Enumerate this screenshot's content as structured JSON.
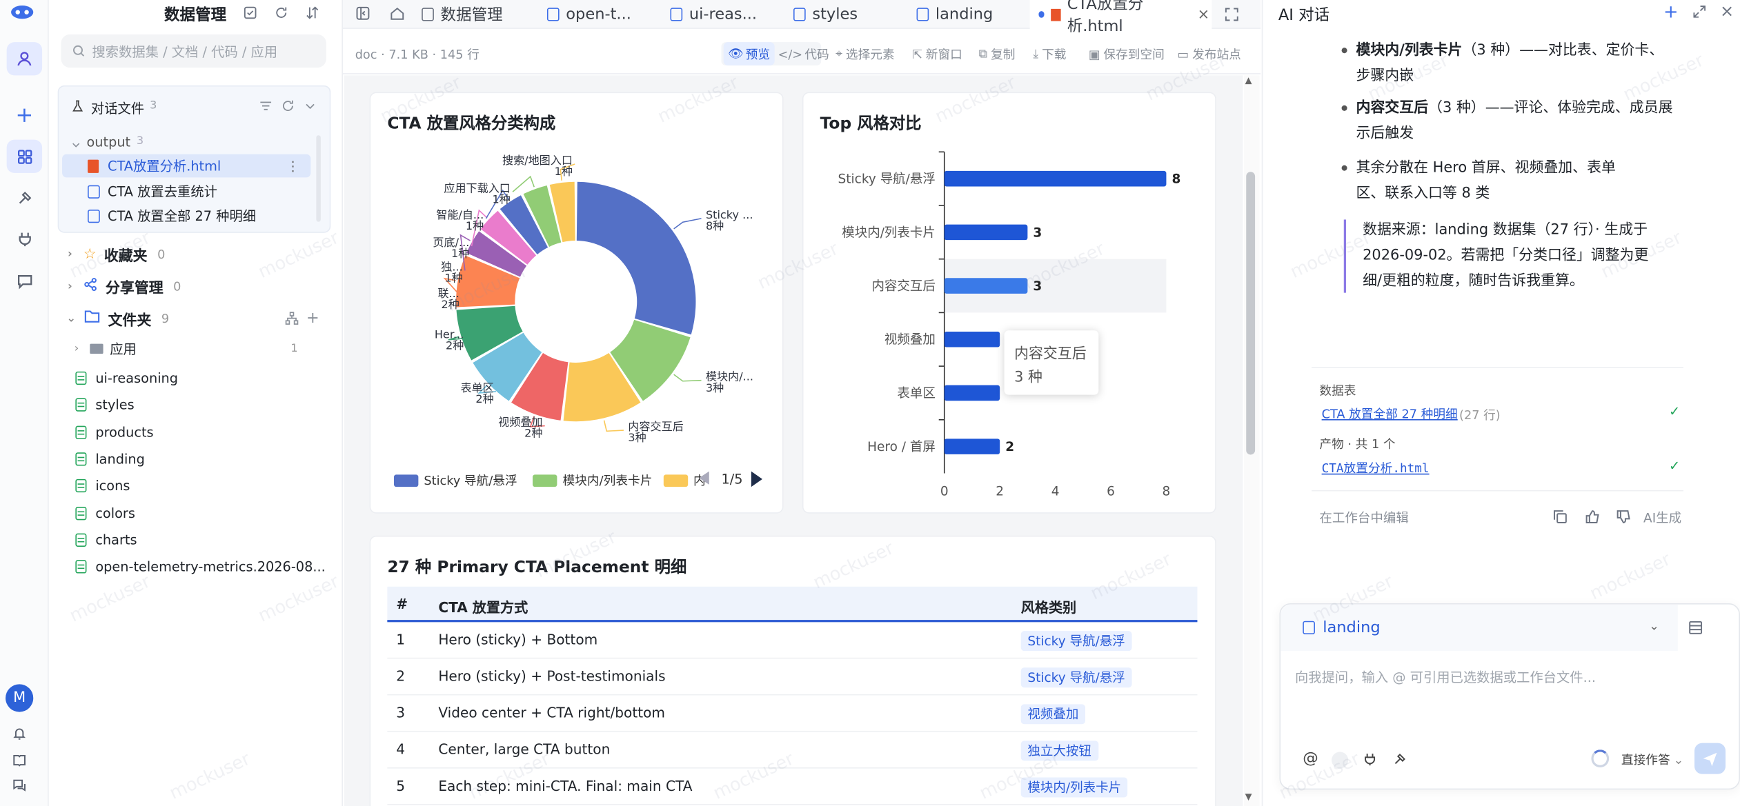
{
  "sidebar": {
    "title": "数据管理",
    "search_placeholder": "搜索数据集 / 文档 / 代码 / 应用",
    "conversation": {
      "label": "对话文件",
      "count": "3"
    },
    "output": {
      "label": "output",
      "count": "3"
    },
    "output_files": [
      "CTA放置分析.html",
      "CTA 放置去重统计",
      "CTA 放置全部 27 种明细"
    ],
    "favorites": {
      "label": "收藏夹",
      "count": "0"
    },
    "shares": {
      "label": "分享管理",
      "count": "0"
    },
    "folders": {
      "label": "文件夹",
      "count": "9"
    },
    "apps": {
      "label": "应用",
      "count": "1"
    },
    "files": [
      "ui-reasoning",
      "styles",
      "products",
      "landing",
      "icons",
      "colors",
      "charts",
      "open-telemetry-metrics.2026-08..."
    ],
    "avatar_letter": "M"
  },
  "tabs": [
    {
      "label": "数据管理"
    },
    {
      "label": "open-t..."
    },
    {
      "label": "ui-reas..."
    },
    {
      "label": "styles"
    },
    {
      "label": "landing"
    },
    {
      "label": "CTA放置分析.html"
    }
  ],
  "toolbar": {
    "meta": "doc · 7.1 KB · 145 行",
    "preview": "预览",
    "code": "代码",
    "select": "选择元素",
    "new_window": "新窗口",
    "copy": "复制",
    "download": "下载",
    "save": "保存到空间",
    "publish": "发布站点"
  },
  "pie_card": {
    "title": "CTA 放置风格分类构成",
    "legend_page": "1/5",
    "legend": [
      {
        "label": "Sticky 导航/悬浮",
        "color": "#5470c6"
      },
      {
        "label": "模块内/列表卡片",
        "color": "#91cc75"
      },
      {
        "label": "内",
        "color": "#fac858"
      }
    ]
  },
  "chart_data": [
    {
      "type": "pie",
      "title": "CTA 放置风格分类构成",
      "slices": [
        {
          "label": "Sticky ...",
          "value": 8,
          "value_label": "8种",
          "color": "#5470c6"
        },
        {
          "label": "模块内/...",
          "value": 3,
          "value_label": "3种",
          "color": "#91cc75"
        },
        {
          "label": "内容交互后",
          "value": 3,
          "value_label": "3种",
          "color": "#fac858"
        },
        {
          "label": "视频叠加",
          "value": 2,
          "value_label": "2种",
          "color": "#ee6666"
        },
        {
          "label": "表单区",
          "value": 2,
          "value_label": "2种",
          "color": "#73c0de"
        },
        {
          "label": "Her...",
          "value": 2,
          "value_label": "2种",
          "color": "#3ba272"
        },
        {
          "label": "联...",
          "value": 2,
          "value_label": "2种",
          "color": "#fc8452"
        },
        {
          "label": "独...",
          "value": 1,
          "value_label": "1种",
          "color": "#9a60b4"
        },
        {
          "label": "页底/...",
          "value": 1,
          "value_label": "1种",
          "color": "#ea7ccc"
        },
        {
          "label": "智能/自...",
          "value": 1,
          "value_label": "1种",
          "color": "#5470c6"
        },
        {
          "label": "应用下载入口",
          "value": 1,
          "value_label": "1种",
          "color": "#91cc75"
        },
        {
          "label": "搜索/地图入口",
          "value": 1,
          "value_label": "1种",
          "color": "#fac858"
        }
      ]
    },
    {
      "type": "bar",
      "orientation": "horizontal",
      "title": "Top 风格对比",
      "categories": [
        "Sticky 导航/悬浮",
        "模块内/列表卡片",
        "内容交互后",
        "视频叠加",
        "表单区",
        "Hero / 首屏"
      ],
      "values": [
        8,
        3,
        3,
        2,
        2,
        2
      ],
      "value_labels": [
        "8",
        "3",
        "3",
        "",
        "",
        "2"
      ],
      "xlim": [
        0,
        8
      ],
      "xticks": [
        "0",
        "2",
        "4",
        "6",
        "8"
      ],
      "bar_color": "#1e56d6",
      "highlight_color": "#3a7ae8",
      "highlight_index": 2,
      "tooltip": {
        "title": "内容交互后",
        "value": "3 种"
      }
    }
  ],
  "table": {
    "title": "27 种 Primary CTA Placement 明细",
    "headers": [
      "#",
      "CTA 放置方式",
      "风格类别"
    ],
    "rows": [
      [
        "1",
        "Hero (sticky) + Bottom",
        "Sticky 导航/悬浮"
      ],
      [
        "2",
        "Hero (sticky) + Post-testimonials",
        "Sticky 导航/悬浮"
      ],
      [
        "3",
        "Video center + CTA right/bottom",
        "视频叠加"
      ],
      [
        "4",
        "Center, large CTA button",
        "独立大按钮"
      ],
      [
        "5",
        "Each step: mini-CTA. Final: main CTA",
        "模块内/列表卡片"
      ]
    ]
  },
  "chat": {
    "title": "AI 对话",
    "bullets": [
      {
        "bold": "模块内/列表卡片",
        "rest": "（3 种）——对比表、定价卡、步骤内嵌"
      },
      {
        "bold": "内容交互后",
        "rest": "（3 种）——评论、体验完成、成员展示后触发"
      },
      {
        "bold": "",
        "rest": "其余分散在 Hero 首屏、视频叠加、表单区、联系入口等 8 类"
      }
    ],
    "quote": "数据来源：landing 数据集（27 行）· 生成于 2026-09-02。若需把「分类口径」调整为更细/更粗的粒度，随时告诉我重算。",
    "table_label": "数据表",
    "table_link": "CTA 放置全部 27 种明细",
    "table_rows": "(27 行)",
    "artifact_label": "产物 · 共 1 个",
    "artifact_link": "CTA放置分析.html",
    "edit_label": "在工作台中编辑",
    "ai_label": "AI生成",
    "dataset": "landing",
    "input_placeholder": "向我提问，输入 @ 可引用已选数据或工作台文件...",
    "mode": "直接作答"
  },
  "watermark": "mockuser"
}
